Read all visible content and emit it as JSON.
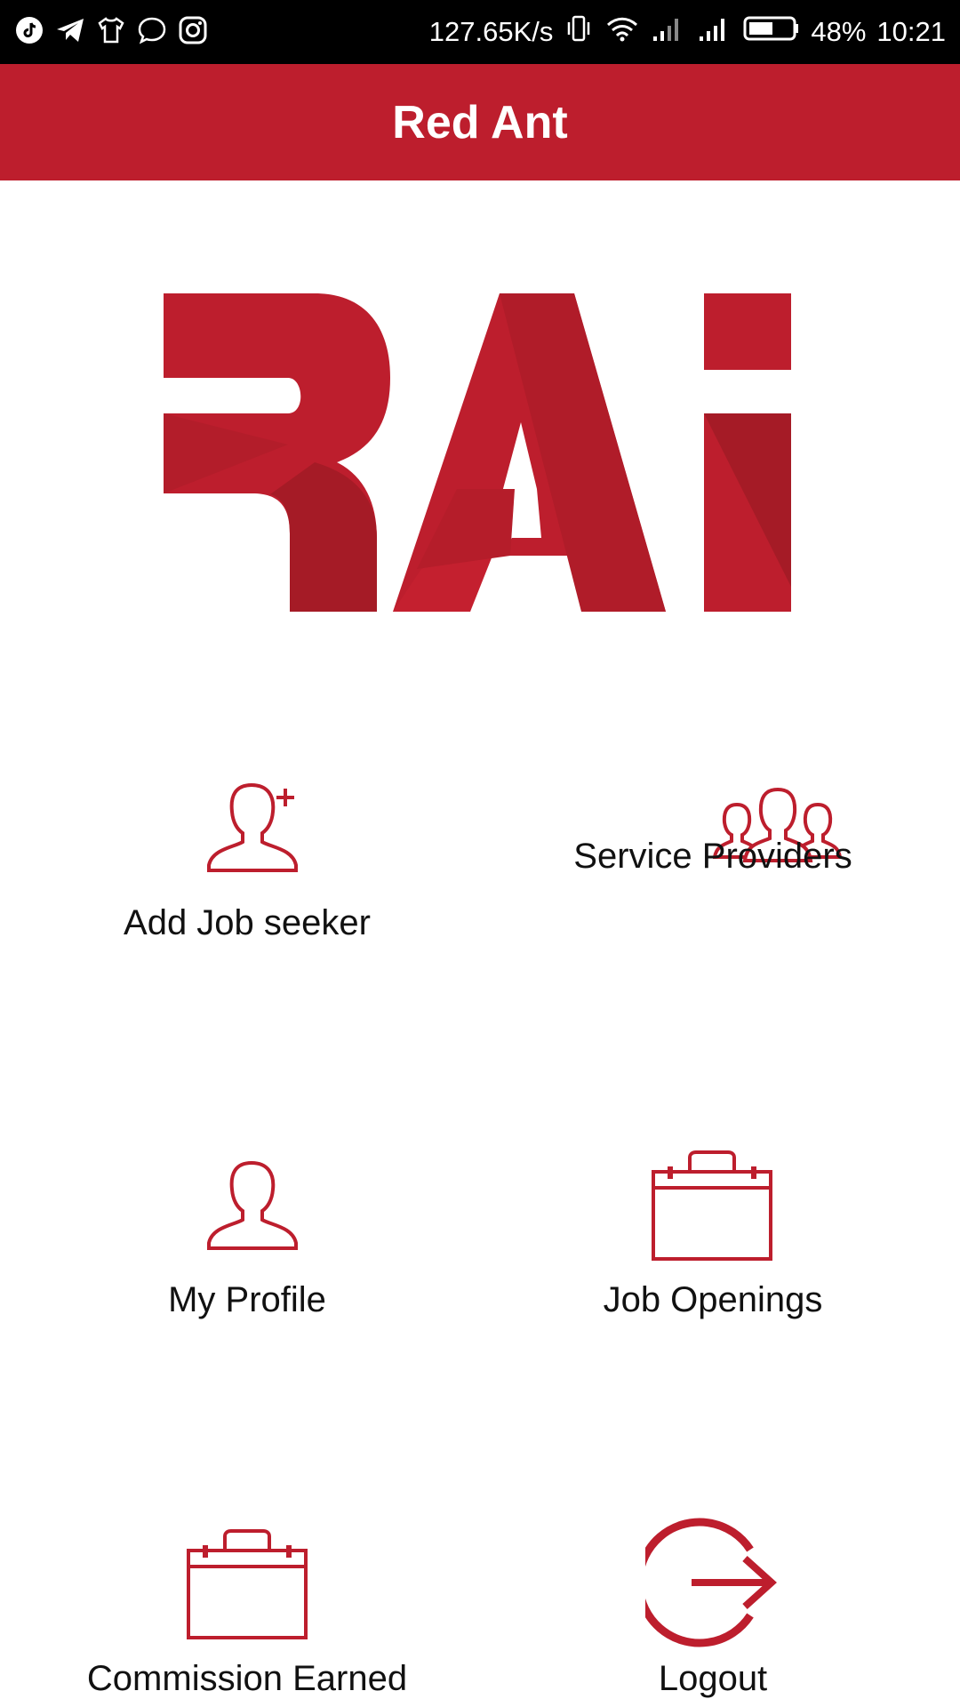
{
  "status_bar": {
    "net_speed": "127.65K/s",
    "battery": "48%",
    "time": "10:21",
    "icons_left": [
      "tiktok-icon",
      "telegram-icon",
      "tshirt-icon",
      "message-icon",
      "instagram-icon"
    ],
    "icons_right": [
      "vibrate-icon",
      "wifi-icon",
      "signal-icon",
      "signal-icon",
      "battery-icon"
    ]
  },
  "header": {
    "title": "Red Ant"
  },
  "logo": {
    "text": "RAi",
    "color": "#bd1e2d"
  },
  "menu": {
    "add_job_seeker": "Add Job seeker",
    "service_providers": "Service Providers",
    "my_profile": "My Profile",
    "job_openings": "Job Openings",
    "commission_earned": "Commission Earned",
    "logout": "Logout"
  },
  "colors": {
    "brand": "#bd1e2d",
    "status_bar": "#000000",
    "text": "#111111"
  }
}
